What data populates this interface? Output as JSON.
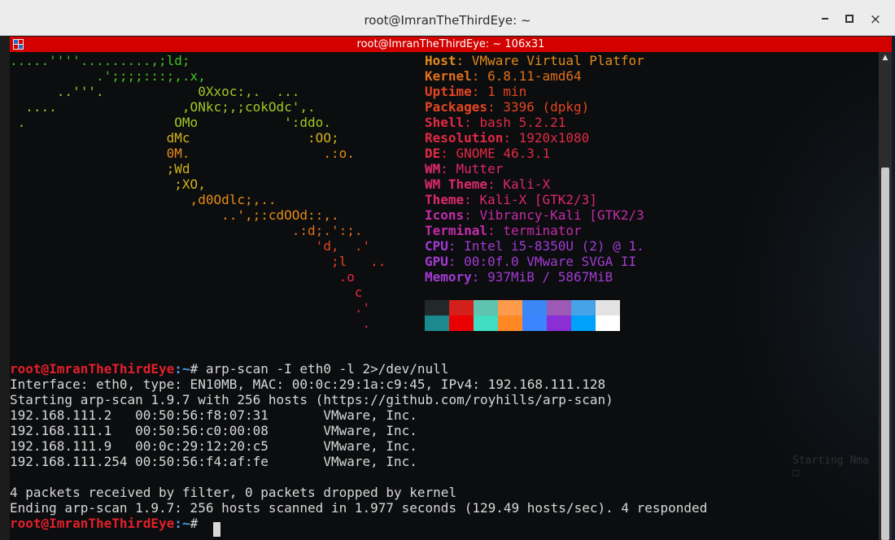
{
  "window": {
    "title": "root@ImranTheThirdEye: ~",
    "min_label": "",
    "max_label": "",
    "close_label": "×"
  },
  "terminator": {
    "title": "root@ImranTheThirdEye: ~ 106x31"
  },
  "logo": [
    {
      "text": ".....''''.........,;ld;",
      "color": "#44c11e"
    },
    {
      "text": "           .';;;;:::;,.x,",
      "color": "#44c11e"
    },
    {
      "text": "      ..'''.            0Xxoc:,.  ...",
      "color": "#a2c724"
    },
    {
      "text": "  ....                ,ONkc;,;cokOdc',.",
      "color": "#a2c724"
    },
    {
      "text": " .                   OMo           ':ddo.",
      "color": "#a2c724"
    },
    {
      "text": "                    dMc               :OO;",
      "color": "#d2b21c"
    },
    {
      "text": "                    0M.                 .:o.",
      "color": "#e48a1b"
    },
    {
      "text": "                    ;Wd",
      "color": "#d2b21c"
    },
    {
      "text": "                     ;XO,",
      "color": "#d2b21c"
    },
    {
      "text": "                       ,d0Odlc;,..",
      "color": "#e48a1b"
    },
    {
      "text": "                           ..',;:cdOOd::,.",
      "color": "#e48a1b"
    },
    {
      "text": "                                    .:d;.':;.",
      "color": "#e26f1a"
    },
    {
      "text": "                                       'd,  .'",
      "color": "#e34522"
    },
    {
      "text": "                                         ;l   ..",
      "color": "#e34522"
    },
    {
      "text": "                                          .o",
      "color": "#e22a44"
    },
    {
      "text": "                                            c",
      "color": "#e22a44"
    },
    {
      "text": "                                            .'",
      "color": "#e22a44"
    },
    {
      "text": "                                             .",
      "color": "#dc2a6a"
    }
  ],
  "sysinfo": [
    {
      "key": "Host",
      "value": ": VMware Virtual Platfor",
      "color": "#e48a1b"
    },
    {
      "key": "Kernel",
      "value": ": 6.8.11-amd64",
      "color": "#e26f1a"
    },
    {
      "key": "Uptime",
      "value": ": 1 min",
      "color": "#e34522"
    },
    {
      "key": "Packages",
      "value": ": 3396 (dpkg)",
      "color": "#e34522"
    },
    {
      "key": "Shell",
      "value": ": bash 5.2.21",
      "color": "#e22a44"
    },
    {
      "key": "Resolution",
      "value": ": 1920x1080",
      "color": "#e22a44"
    },
    {
      "key": "DE",
      "value": ": GNOME 46.3.1",
      "color": "#e22a44"
    },
    {
      "key": "WM",
      "value": ": Mutter",
      "color": "#dc2a6a"
    },
    {
      "key": "WM Theme",
      "value": ": Kali-X",
      "color": "#dc2a6a"
    },
    {
      "key": "Theme",
      "value": ": Kali-X [GTK2/3]",
      "color": "#dc2a6a"
    },
    {
      "key": "Icons",
      "value": ": Vibrancy-Kali [GTK2/3",
      "color": "#c42ca9"
    },
    {
      "key": "Terminal",
      "value": ": terminator",
      "color": "#c42ca9"
    },
    {
      "key": "CPU",
      "value": ": Intel i5-8350U (2) @ 1.",
      "color": "#a33bd2"
    },
    {
      "key": "GPU",
      "value": ": 00:0f.0 VMware SVGA II",
      "color": "#a33bd2"
    },
    {
      "key": "Memory",
      "value": ": 937MiB / 5867MiB",
      "color": "#a33bd2"
    }
  ],
  "palette": {
    "row1": [
      "#23282b",
      "#d3201c",
      "#5ec4b0",
      "#fe9b4b",
      "#3b87f5",
      "#9c59b6",
      "#47a3e7",
      "#e3e3e3"
    ],
    "row2": [
      "#1b8a8e",
      "#ea0000",
      "#40ddc2",
      "#fe8823",
      "#3b86ff",
      "#8b2ed6",
      "#00a1f9",
      "#ffffff"
    ]
  },
  "prompt": {
    "user": "root@ImranTheThirdEye",
    "path": ":~",
    "symbol": "# "
  },
  "command": "arp-scan -I eth0 -l 2>/dev/null",
  "output": [
    "Interface: eth0, type: EN10MB, MAC: 00:0c:29:1a:c9:45, IPv4: 192.168.111.128",
    "Starting arp-scan 1.9.7 with 256 hosts (https://github.com/royhills/arp-scan)",
    "192.168.111.2   00:50:56:f8:07:31       VMware, Inc.",
    "192.168.111.1   00:50:56:c0:00:08       VMware, Inc.",
    "192.168.111.9   00:0c:29:12:20:c5       VMware, Inc.",
    "192.168.111.254 00:50:56:f4:af:fe       VMware, Inc.",
    "",
    "4 packets received by filter, 0 packets dropped by kernel",
    "Ending arp-scan 1.9.7: 256 hosts scanned in 1.977 seconds (129.49 hosts/sec). 4 responded"
  ],
  "colors": {
    "terminator_header": "#d30000",
    "prompt_user": "#e2202a",
    "prompt_path": "#4d9ee6"
  }
}
